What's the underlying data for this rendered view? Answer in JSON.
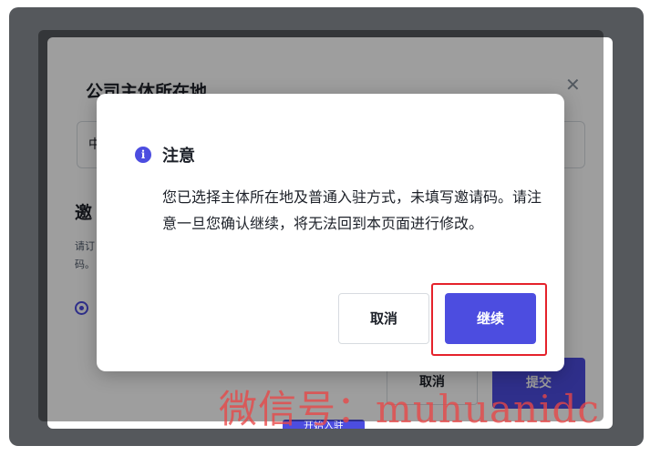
{
  "background_form": {
    "title": "公司主体所在地",
    "select_value": "中",
    "section_title": "邀",
    "description": "请订\n码。",
    "cancel_label": "取消",
    "submit_label": "提交",
    "bottom_button_label": "开始入驻"
  },
  "dialog": {
    "icon": "info-icon",
    "title": "注意",
    "body": "您已选择主体所在地及普通入驻方式，未填写邀请码。请注意一旦您确认继续，将无法回到本页面进行修改。",
    "cancel_label": "取消",
    "continue_label": "继续"
  },
  "watermark": {
    "text": "微信号：muhuanidc"
  },
  "colors": {
    "accent": "#4c4de0",
    "highlight_border": "#e5222b",
    "frame": "#55585c"
  }
}
